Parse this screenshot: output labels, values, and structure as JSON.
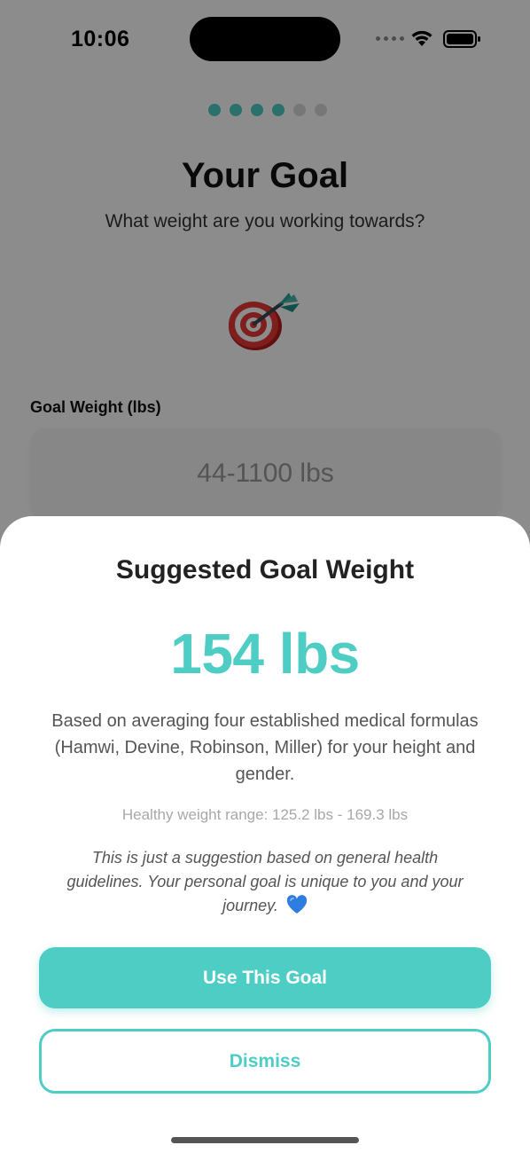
{
  "status_bar": {
    "time": "10:06",
    "icons": [
      "signal-dots-icon",
      "wifi-icon",
      "battery-icon"
    ]
  },
  "onboarding": {
    "progress": {
      "total_steps": 6,
      "completed_steps": 4
    },
    "title": "Your Goal",
    "subtitle": "What weight are you working towards?",
    "hero_icon": "target-dart-icon",
    "goal_weight": {
      "label": "Goal Weight (lbs)",
      "placeholder": "44-1100 lbs",
      "value": ""
    }
  },
  "sheet": {
    "title": "Suggested Goal Weight",
    "value": "154 lbs",
    "description": "Based on averaging four established medical formulas (Hamwi, Devine, Robinson, Miller) for your height and gender.",
    "range": "Healthy weight range: 125.2 lbs - 169.3 lbs",
    "note": "This is just a suggestion based on general health guidelines. Your personal goal is unique to you and your journey.",
    "note_icon": "blue-heart-icon",
    "primary_button": "Use This Goal",
    "secondary_button": "Dismiss"
  },
  "colors": {
    "accent": "#4ecdc4",
    "overlay": "rgba(0,0,0,0.45)",
    "heart": "#2f7de1"
  }
}
